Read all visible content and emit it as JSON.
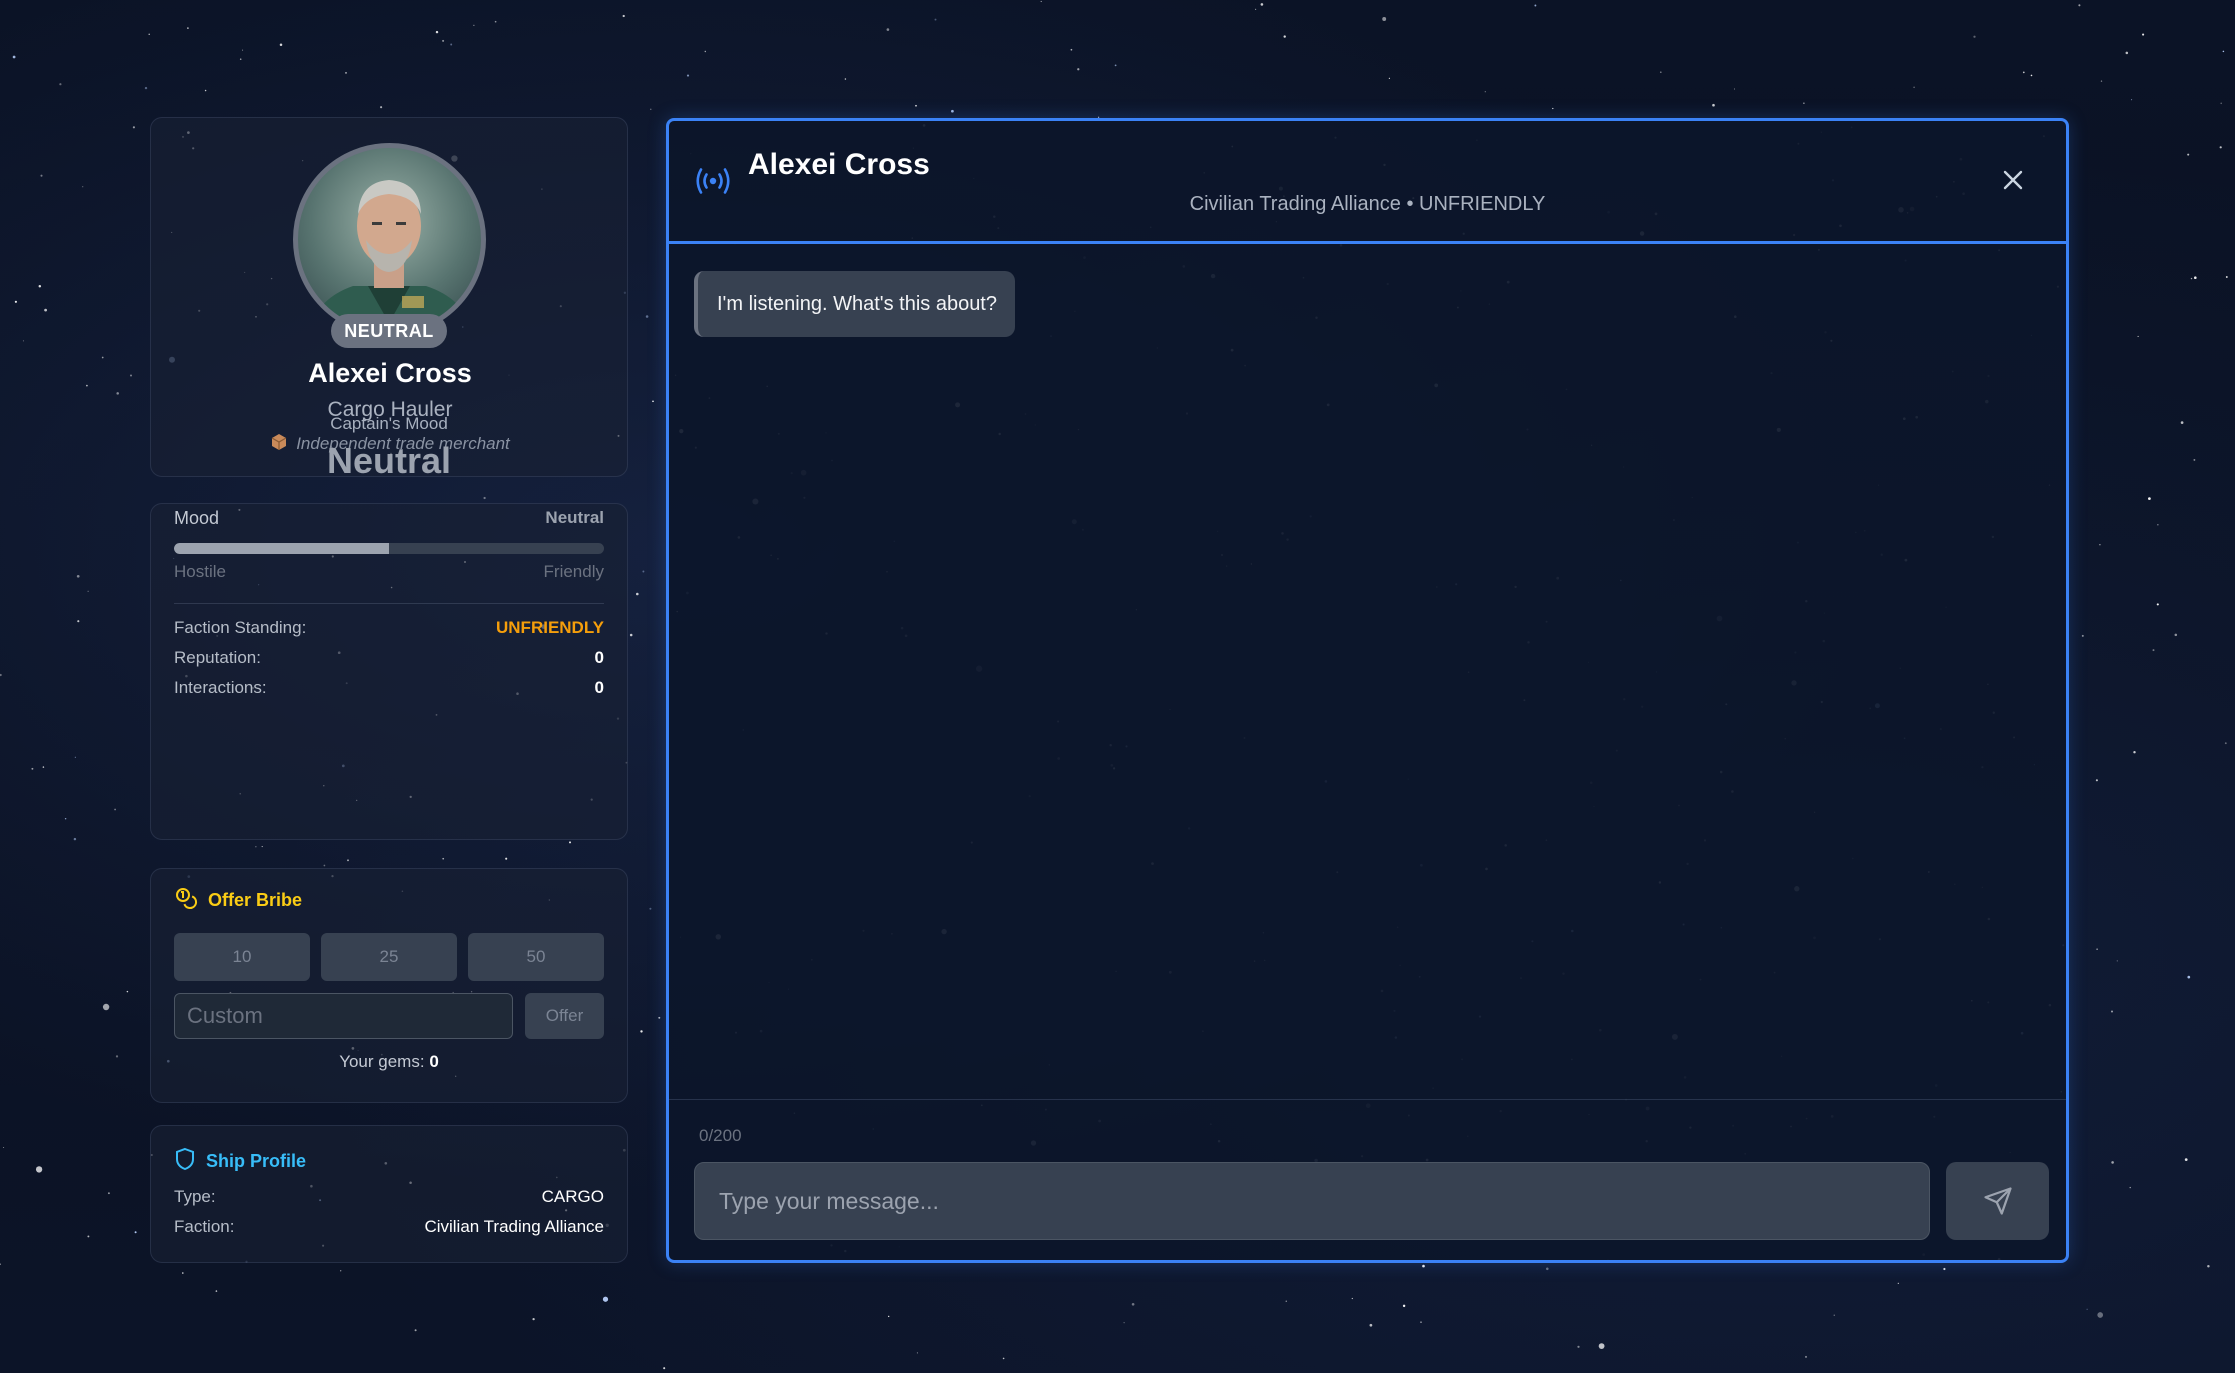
{
  "npc": {
    "name": "Alexei Cross",
    "role": "Cargo Hauler",
    "description": "Independent trade merchant",
    "status": "NEUTRAL",
    "avatar_icon": "captain-portrait-icon"
  },
  "mood": {
    "title": "Captain's Mood",
    "value": "Neutral",
    "label": "Mood",
    "level_label": "Neutral",
    "level_fraction": 0.5,
    "scale_min": "Hostile",
    "scale_max": "Friendly"
  },
  "stats": [
    {
      "label": "Faction Standing:",
      "value": "UNFRIENDLY"
    },
    {
      "label": "Reputation:",
      "value": "0"
    },
    {
      "label": "Interactions:",
      "value": "0"
    }
  ],
  "bribe": {
    "title": "Offer Bribe",
    "amounts": [
      "10",
      "25",
      "50"
    ],
    "custom_placeholder": "Custom",
    "offer_label": "Offer",
    "gems_label": "Your gems:",
    "gems_value": "0"
  },
  "ship": {
    "title": "Ship Profile",
    "rows": [
      {
        "label": "Type:",
        "value": "CARGO"
      },
      {
        "label": "Faction:",
        "value": "Civilian Trading Alliance"
      }
    ]
  },
  "chat": {
    "title": "Alexei Cross",
    "subtitle": "Civilian Trading Alliance • UNFRIENDLY",
    "messages": [
      {
        "from": "npc",
        "text": "I'm listening. What's this about?"
      }
    ],
    "char_counter": "0/200",
    "input_placeholder": "Type your message..."
  },
  "colors": {
    "accent": "#3b82f6",
    "warning": "#f59e0b",
    "bribe": "#facc15",
    "ship": "#38bdf8",
    "neutral": "#9ca3af"
  }
}
